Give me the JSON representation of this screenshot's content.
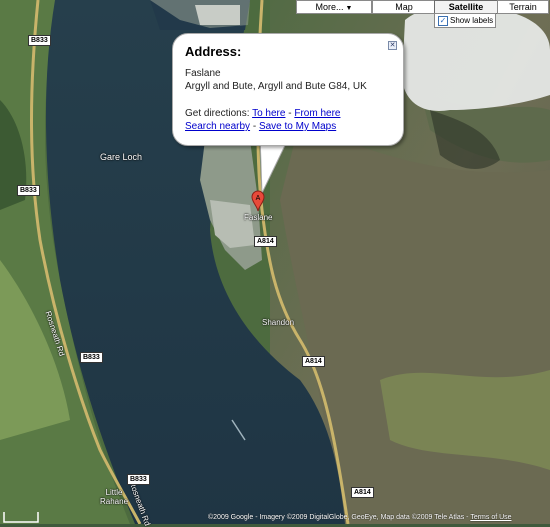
{
  "map_types": {
    "more": "More...",
    "map": "Map",
    "satellite": "Satellite",
    "terrain": "Terrain",
    "active": "Satellite"
  },
  "show_labels": {
    "label": "Show labels",
    "checked": true
  },
  "info_window": {
    "title": "Address:",
    "place": "Faslane",
    "address": "Argyll and Bute, Argyll and Bute G84, UK",
    "directions_prefix": "Get directions:",
    "to_here": "To here",
    "from_here": "From here",
    "search_nearby": "Search nearby",
    "save_to_my_maps": "Save to My Maps",
    "separator": " - "
  },
  "marker": {
    "letter": "A"
  },
  "labels": {
    "gare_loch": "Gare Loch",
    "faslane": "Faslane",
    "shandon": "Shandon",
    "little_rahane": "Little\nRahane",
    "rosneath_rd_1": "Rosneath Rd",
    "rosneath_rd_2": "Rosneath Rd"
  },
  "roads": {
    "b833_a": "B833",
    "b833_b": "B833",
    "b833_c": "B833",
    "b833_d": "B833",
    "a814_a": "A814",
    "a814_b": "A814",
    "a814_c": "A814"
  },
  "footer": {
    "attribution": "©2009 Google - Imagery ©2009 DigitalGlobe, GeoEye, Map data ©2009 Tele Atlas - ",
    "terms": "Terms of Use"
  }
}
